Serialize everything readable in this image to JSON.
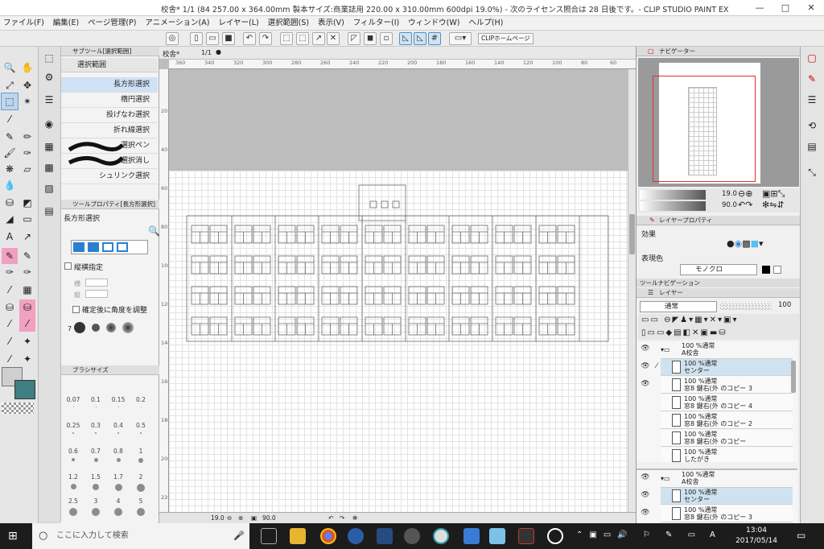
{
  "window": {
    "title": "校舎* 1/1 (84 257.00 x 364.00mm 製本サイズ:商業誌用 220.00 x 310.00mm 600dpi 19.0%)  - 次のライセンス照合は 28 日後です。- CLIP STUDIO PAINT EX",
    "minimize": "—",
    "maximize": "□",
    "close": "✕"
  },
  "menu": [
    "ファイル(F)",
    "編集(E)",
    "ページ管理(P)",
    "アニメーション(A)",
    "レイヤー(L)",
    "選択範囲(S)",
    "表示(V)",
    "フィルター(I)",
    "ウィンドウ(W)",
    "ヘルプ(H)"
  ],
  "command_bar": {
    "clip_home": "CLIPホームページ"
  },
  "sub_tool": {
    "header": "サブツール[選択範囲]",
    "group": "選択範囲",
    "items": [
      "長方形選択",
      "楕円選択",
      "投げなわ選択",
      "折れ線選択",
      "選択ペン",
      "選択消し",
      "シュリンク選択"
    ],
    "selected_index": 0
  },
  "tool_property": {
    "header": "ツールプロパティ[長方形選択]",
    "title": "長方形選択",
    "aspect_label": "縦横指定",
    "w_label": "横",
    "h_label": "縦",
    "angle_label": "確定後に角度を調整",
    "aa_label": "7"
  },
  "brush_size": {
    "header": "ブラシサイズ",
    "sizes": [
      "0.07",
      "0.1",
      "0.15",
      "0.2",
      "0.25",
      "0.3",
      "0.4",
      "0.5",
      "0.6",
      "0.7",
      "0.8",
      "1",
      "1.2",
      "1.5",
      "1.7",
      "2",
      "2.5",
      "3",
      "4",
      "5"
    ]
  },
  "canvas": {
    "tab_label": "校舎*",
    "page_label": "1/1",
    "ruler_h": [
      "360",
      "340",
      "320",
      "300",
      "280",
      "260",
      "240",
      "220",
      "200",
      "180",
      "160",
      "140",
      "120",
      "100",
      "80",
      "60"
    ],
    "ruler_v": [
      "20",
      "40",
      "60",
      "80",
      "100",
      "120",
      "140",
      "160",
      "180",
      "200",
      "220"
    ],
    "zoom": "19.0",
    "angle": "90.0"
  },
  "navigator": {
    "header": "ナビゲーター",
    "zoom": "19.0",
    "angle": "90.0"
  },
  "layer_property": {
    "header": "レイヤープロパティ",
    "effect_label": "効果",
    "color_label": "表現色",
    "color_value": "モノクロ",
    "tool_nav": "ツールナビゲーション"
  },
  "layers": {
    "header": "レイヤー",
    "blend": "通常",
    "opacity": "100",
    "list": [
      {
        "a": "100 %通常",
        "b": "A校舎",
        "folder": true
      },
      {
        "a": "100 %通常",
        "b": "センター",
        "selected": true
      },
      {
        "a": "100 %通常",
        "b": "窓8 鍵右(外 のコピー 3"
      },
      {
        "a": "100 %通常",
        "b": "窓8 鍵右(外 のコピー 4"
      },
      {
        "a": "100 %通常",
        "b": "窓8 鍵右(外 のコピー 2"
      },
      {
        "a": "100 %通常",
        "b": "窓8 鍵右(外 のコピー"
      },
      {
        "a": "100 %通常",
        "b": "したがき"
      }
    ],
    "list2": [
      {
        "a": "100 %通常",
        "b": "A校舎",
        "folder": true
      },
      {
        "a": "100 %通常",
        "b": "センター",
        "selected": true
      },
      {
        "a": "100 %通常",
        "b": "窓8 鍵右(外 のコピー 3"
      }
    ]
  },
  "taskbar": {
    "search_placeholder": "ここに入力して検索",
    "time": "13:04",
    "date": "2017/05/14",
    "ime": "A"
  }
}
